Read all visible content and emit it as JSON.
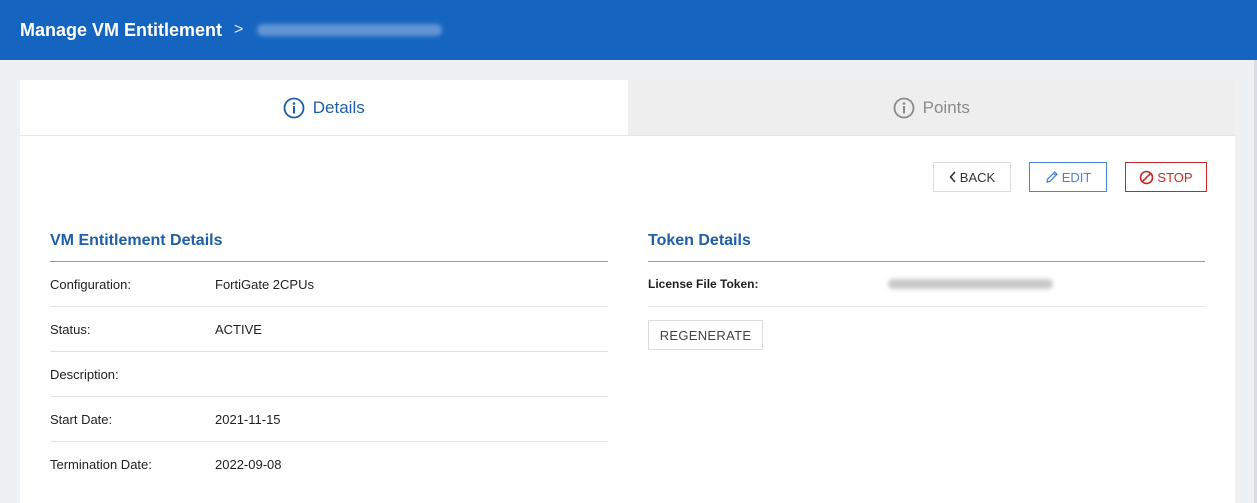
{
  "header": {
    "title": "Manage VM Entitlement",
    "separator": ">"
  },
  "tabs": [
    {
      "label": "Details",
      "active": true
    },
    {
      "label": "Points",
      "active": false
    }
  ],
  "actions": {
    "back_label": "BACK",
    "edit_label": "EDIT",
    "stop_label": "STOP"
  },
  "vm_details": {
    "title": "VM Entitlement Details",
    "rows": [
      {
        "label": "Configuration:",
        "value": "FortiGate 2CPUs"
      },
      {
        "label": "Status:",
        "value": "ACTIVE"
      },
      {
        "label": "Description:",
        "value": ""
      },
      {
        "label": "Start Date:",
        "value": "2021-11-15"
      },
      {
        "label": "Termination Date:",
        "value": "2022-09-08"
      }
    ]
  },
  "token_details": {
    "title": "Token Details",
    "license_label": "License File Token:",
    "regenerate_label": "REGENERATE"
  },
  "colors": {
    "header_bg": "#1565c0",
    "accent": "#1f5fa8",
    "stop": "#c62828",
    "edit": "#4a86d0"
  }
}
